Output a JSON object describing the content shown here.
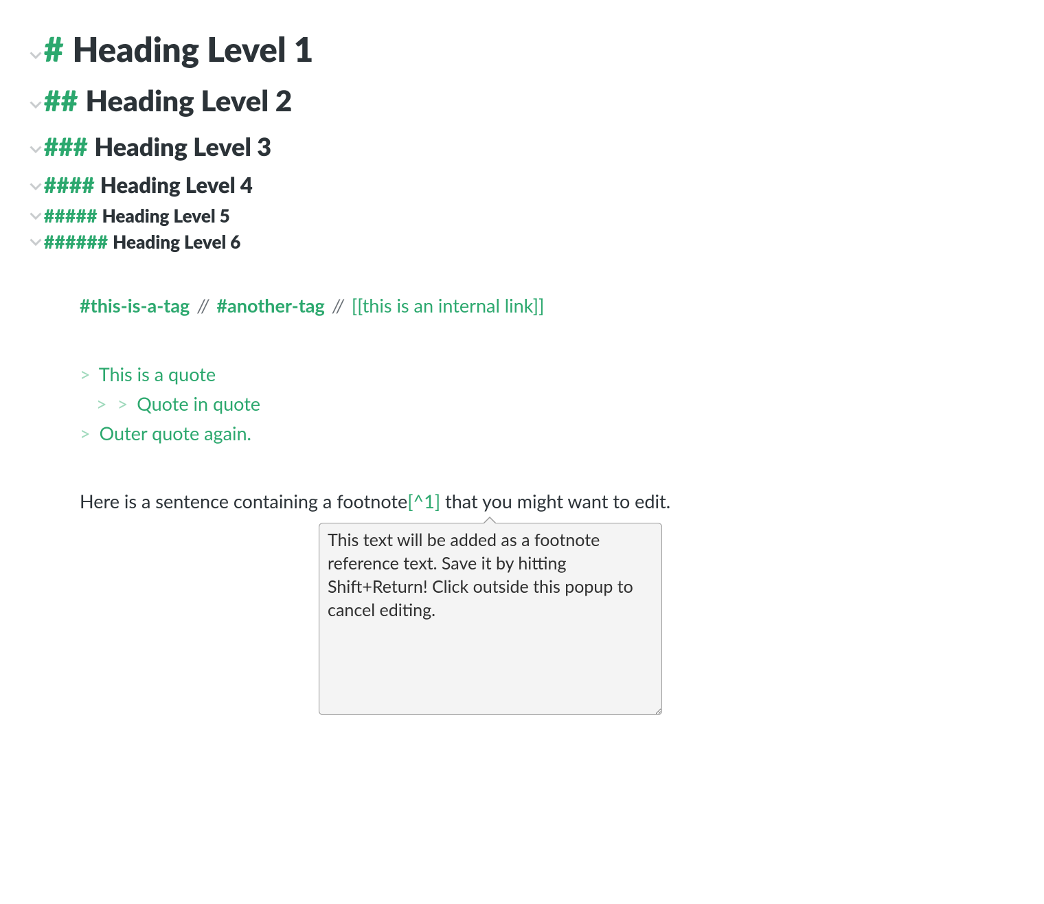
{
  "headings": [
    {
      "hashes": "#",
      "text": "Heading Level 1"
    },
    {
      "hashes": "##",
      "text": "Heading Level 2"
    },
    {
      "hashes": "###",
      "text": "Heading Level 3"
    },
    {
      "hashes": "####",
      "text": "Heading Level 4"
    },
    {
      "hashes": "#####",
      "text": "Heading Level 5"
    },
    {
      "hashes": "######",
      "text": "Heading Level 6"
    }
  ],
  "tags_line": {
    "tag1": "#this-is-a-tag",
    "separator": "//",
    "tag2": "#another-tag",
    "internal_link": "[[this is an internal link]]"
  },
  "quotes": {
    "marker": ">",
    "line1": "This is a quote",
    "line2": "Quote in quote",
    "line3": "Outer quote again."
  },
  "footnote": {
    "before": "Here is a sentence containing a footnote",
    "ref": "[^1]",
    "after": " that you might want to edit."
  },
  "popup_text": "This text will be added as a footnote reference text. Save it by hitting Shift+Return! Click outside this popup to cancel editing."
}
